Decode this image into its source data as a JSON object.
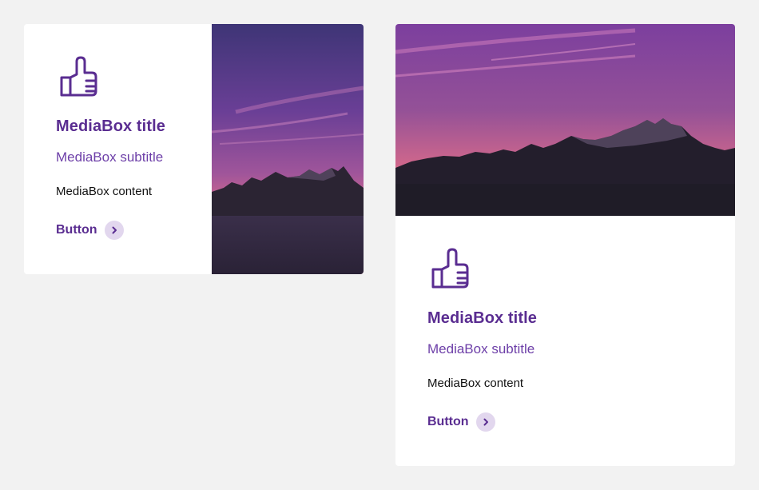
{
  "colors": {
    "background": "#f2f2f2",
    "card": "#ffffff",
    "accent": "#5a2d91",
    "subtitle": "#6d3fa8",
    "chevron_bg": "#e2d7ee"
  },
  "cards": [
    {
      "layout": "image-right",
      "icon": "thumbs-up-icon",
      "title": "MediaBox title",
      "subtitle": "MediaBox subtitle",
      "content": "MediaBox content",
      "button_label": "Button",
      "button_icon": "chevron-right-icon",
      "image": "sunset-mountains-photo"
    },
    {
      "layout": "image-top",
      "icon": "thumbs-up-icon",
      "title": "MediaBox title",
      "subtitle": "MediaBox subtitle",
      "content": "MediaBox content",
      "button_label": "Button",
      "button_icon": "chevron-right-icon",
      "image": "sunset-mountains-photo"
    }
  ]
}
